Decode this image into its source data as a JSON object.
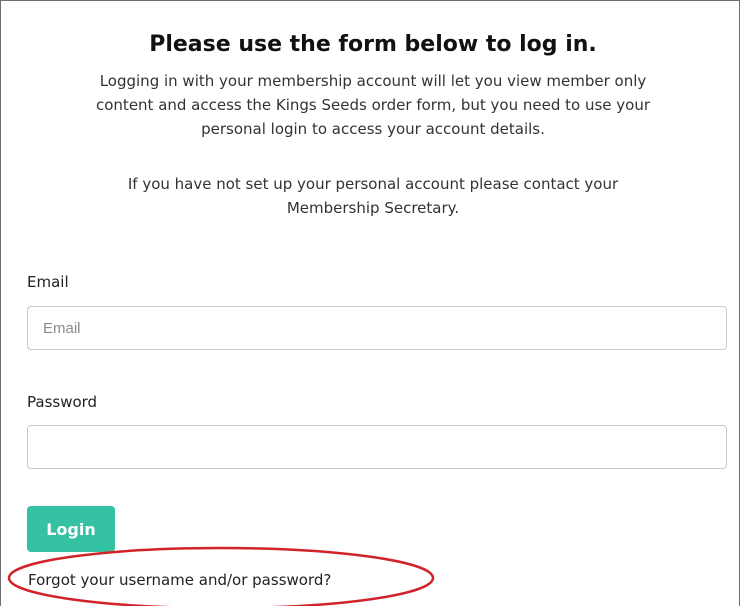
{
  "form": {
    "title": "Please use the form below to log in.",
    "intro_line_1": "Logging in with your membership account will let you view member only",
    "intro_line_2": "content and access the Kings Seeds order form, but you need to use your",
    "intro_line_3": "personal login to access your account details.",
    "contact_line_1": "If you have not set up your personal account please contact your",
    "contact_line_2": "Membership Secretary.",
    "email_label": "Email",
    "email_placeholder": "Email",
    "email_value": "",
    "password_label": "Password",
    "password_value": "",
    "login_label": "Login",
    "forgot_link": "Forgot your username and/or password?"
  },
  "colors": {
    "accent": "#35c2a3",
    "highlight": "#d2232a"
  }
}
